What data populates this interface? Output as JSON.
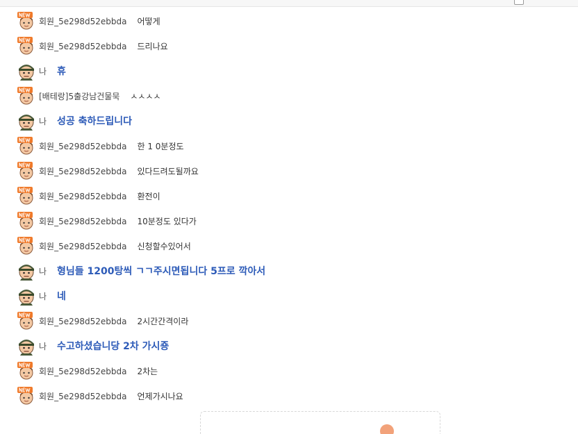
{
  "messages": [
    {
      "kind": "other",
      "nick": "회원_5e298d52ebbda",
      "text": "어떻게"
    },
    {
      "kind": "other",
      "nick": "회원_5e298d52ebbda",
      "text": "드리나요"
    },
    {
      "kind": "me",
      "nick": "나",
      "text": "휴"
    },
    {
      "kind": "other",
      "nick": "[배테랑]5출강남건물묵",
      "text": "ㅅㅅㅅㅅ"
    },
    {
      "kind": "me",
      "nick": "나",
      "text": "성공 축하드립니다"
    },
    {
      "kind": "other",
      "nick": "회원_5e298d52ebbda",
      "text": "한 1 0분정도"
    },
    {
      "kind": "other",
      "nick": "회원_5e298d52ebbda",
      "text": "있다드려도될까요"
    },
    {
      "kind": "other",
      "nick": "회원_5e298d52ebbda",
      "text": "환전이"
    },
    {
      "kind": "other",
      "nick": "회원_5e298d52ebbda",
      "text": "10분정도 있다가"
    },
    {
      "kind": "other",
      "nick": "회원_5e298d52ebbda",
      "text": "신청할수있어서"
    },
    {
      "kind": "me",
      "nick": "나",
      "text": "형님들 1200탕씩 ㄱㄱ주시면됩니다 5프로 깍아서"
    },
    {
      "kind": "me",
      "nick": "나",
      "text": "네"
    },
    {
      "kind": "other",
      "nick": "회원_5e298d52ebbda",
      "text": "2시간간격이라"
    },
    {
      "kind": "me",
      "nick": "나",
      "text": "수고하셨습니당 2차 가시죵"
    },
    {
      "kind": "other",
      "nick": "회원_5e298d52ebbda",
      "text": "2차는"
    },
    {
      "kind": "other",
      "nick": "회원_5e298d52ebbda",
      "text": "언제가시나요"
    }
  ],
  "icons": {
    "other": "new-member-avatar-icon",
    "me": "soldier-avatar-icon"
  },
  "colors": {
    "my_text": "#2d5bb8",
    "new_badge": "#f07a2a"
  }
}
